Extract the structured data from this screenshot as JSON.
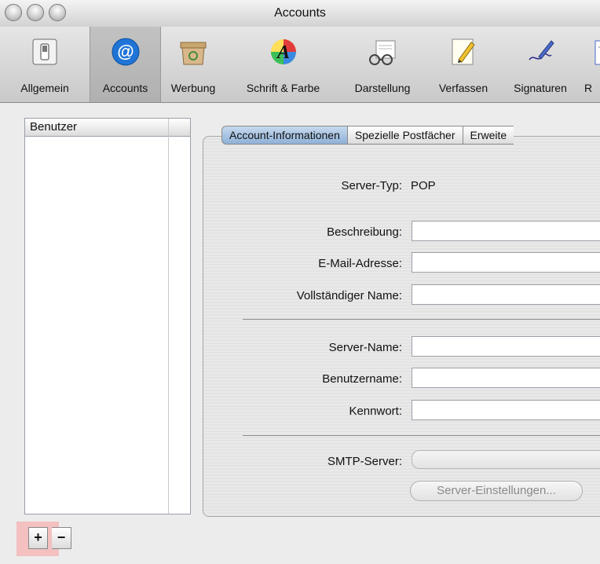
{
  "window": {
    "title": "Accounts"
  },
  "toolbar": {
    "items": [
      {
        "label": "Allgemein",
        "icon": "switch-icon"
      },
      {
        "label": "Accounts",
        "icon": "at-sign-icon",
        "selected": true
      },
      {
        "label": "Werbung",
        "icon": "trash-mail-icon"
      },
      {
        "label": "Schrift & Farbe",
        "icon": "color-font-icon"
      },
      {
        "label": "Darstellung",
        "icon": "glasses-icon"
      },
      {
        "label": "Verfassen",
        "icon": "pencil-paper-icon"
      },
      {
        "label": "Signaturen",
        "icon": "pen-signature-icon"
      },
      {
        "label": "R",
        "icon": "rules-icon"
      }
    ]
  },
  "sidebar": {
    "header": "Benutzer",
    "add_label": "+",
    "remove_label": "−"
  },
  "tabs": [
    {
      "label": "Account-Informationen",
      "active": true
    },
    {
      "label": "Spezielle Postfächer"
    },
    {
      "label": "Erweite"
    }
  ],
  "form": {
    "server_type_label": "Server-Typ:",
    "server_type_value": "POP",
    "description_label": "Beschreibung:",
    "email_label": "E-Mail-Adresse:",
    "fullname_label": "Vollständiger Name:",
    "servername_label": "Server-Name:",
    "username_label": "Benutzername:",
    "password_label": "Kennwort:",
    "smtp_label": "SMTP-Server:",
    "server_settings_button": "Server-Einstellungen..."
  }
}
